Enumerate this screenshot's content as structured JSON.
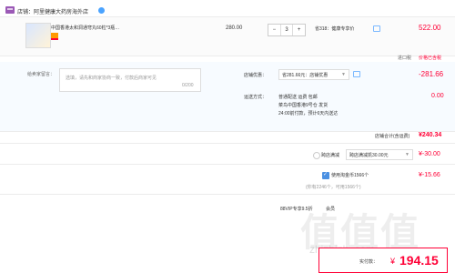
{
  "shop": {
    "name": "店铺：阿里健康大药房海外店"
  },
  "item": {
    "title": "中国香港太和洞通穹丸60粒*3瓶…",
    "price": "280.00",
    "qty_minus": "−",
    "qty": "3",
    "qty_plus": "+",
    "promo": "省318：健康专享价",
    "subtotal": "522.00"
  },
  "tax": {
    "label": "进口税",
    "value": "价格已含税"
  },
  "message": {
    "label": "给卖家留言：",
    "placeholder": "选填，请先和商家协商一致，付款后商家可见",
    "counter": "0/200"
  },
  "coupon": {
    "label": "店铺优惠：",
    "selected": "省281.66元：店铺优惠",
    "amount": "-281.66"
  },
  "delivery": {
    "label": "运送方式：",
    "line1": "普通配送 运费 包邮",
    "line2": "菜鸟中国香港9号仓 发货",
    "line3": "24:00前付款，预计6天内送达",
    "fee": "0.00"
  },
  "shop_total": {
    "label": "店铺合计(含运费)",
    "value": "¥240.34"
  },
  "cross_border": {
    "label": "跨店满减",
    "selected": "跨店满减凯30.00元",
    "amount": "¥-30.00"
  },
  "coins": {
    "label": "使用淘金币1566个",
    "note": "(你有2246个，可用1566个)",
    "amount": "¥-15.66"
  },
  "vip": {
    "label": "88VIP专享9.5折",
    "extra": "会员"
  },
  "final": {
    "label": "实付款：",
    "currency": "¥",
    "value": "194.15"
  },
  "watermark": {
    "big": "值值值",
    "small": "zhizhizhi.com"
  }
}
